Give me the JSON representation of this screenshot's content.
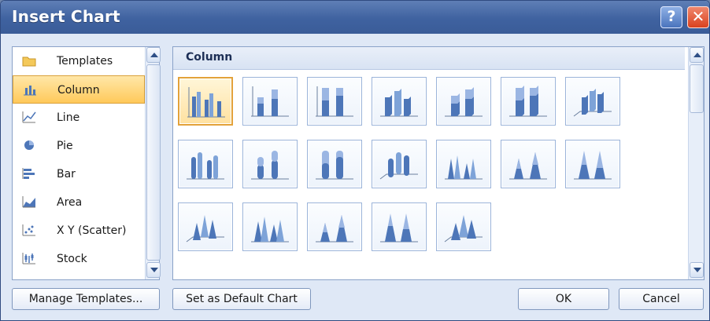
{
  "window": {
    "title": "Insert Chart",
    "help_symbol": "?",
    "close_symbol": "✕"
  },
  "sidebar": {
    "items": [
      {
        "label": "Templates",
        "icon": "folder-icon"
      },
      {
        "label": "Column",
        "icon": "column-chart-icon"
      },
      {
        "label": "Line",
        "icon": "line-chart-icon"
      },
      {
        "label": "Pie",
        "icon": "pie-chart-icon"
      },
      {
        "label": "Bar",
        "icon": "bar-chart-icon"
      },
      {
        "label": "Area",
        "icon": "area-chart-icon"
      },
      {
        "label": "X Y (Scatter)",
        "icon": "scatter-chart-icon"
      },
      {
        "label": "Stock",
        "icon": "stock-chart-icon"
      }
    ],
    "selected": "Column"
  },
  "main": {
    "group_title": "Column",
    "thumbnails": [
      {
        "icon": "clustered-column-icon"
      },
      {
        "icon": "stacked-column-icon"
      },
      {
        "icon": "100-percent-stacked-column-icon"
      },
      {
        "icon": "3d-clustered-column-icon"
      },
      {
        "icon": "3d-stacked-column-icon"
      },
      {
        "icon": "3d-100-percent-stacked-column-icon"
      },
      {
        "icon": "3d-column-icon"
      },
      {
        "icon": "clustered-cylinder-icon"
      },
      {
        "icon": "stacked-cylinder-icon"
      },
      {
        "icon": "100-percent-stacked-cylinder-icon"
      },
      {
        "icon": "3d-cylinder-icon"
      },
      {
        "icon": "clustered-cone-icon"
      },
      {
        "icon": "stacked-cone-icon"
      },
      {
        "icon": "100-percent-stacked-cone-icon"
      },
      {
        "icon": "3d-cone-icon"
      },
      {
        "icon": "clustered-pyramid-icon"
      },
      {
        "icon": "stacked-pyramid-icon"
      },
      {
        "icon": "100-percent-stacked-pyramid-icon"
      },
      {
        "icon": "3d-pyramid-icon"
      }
    ],
    "selected_thumbnail": "clustered-column-icon"
  },
  "buttons": {
    "manage_templates": "Manage Templates...",
    "set_default": "Set as Default Chart",
    "ok": "OK",
    "cancel": "Cancel"
  },
  "colors": {
    "accent": "#3f62a0",
    "selection": "#ffc95a",
    "chart_blue": "#4d76b8"
  }
}
